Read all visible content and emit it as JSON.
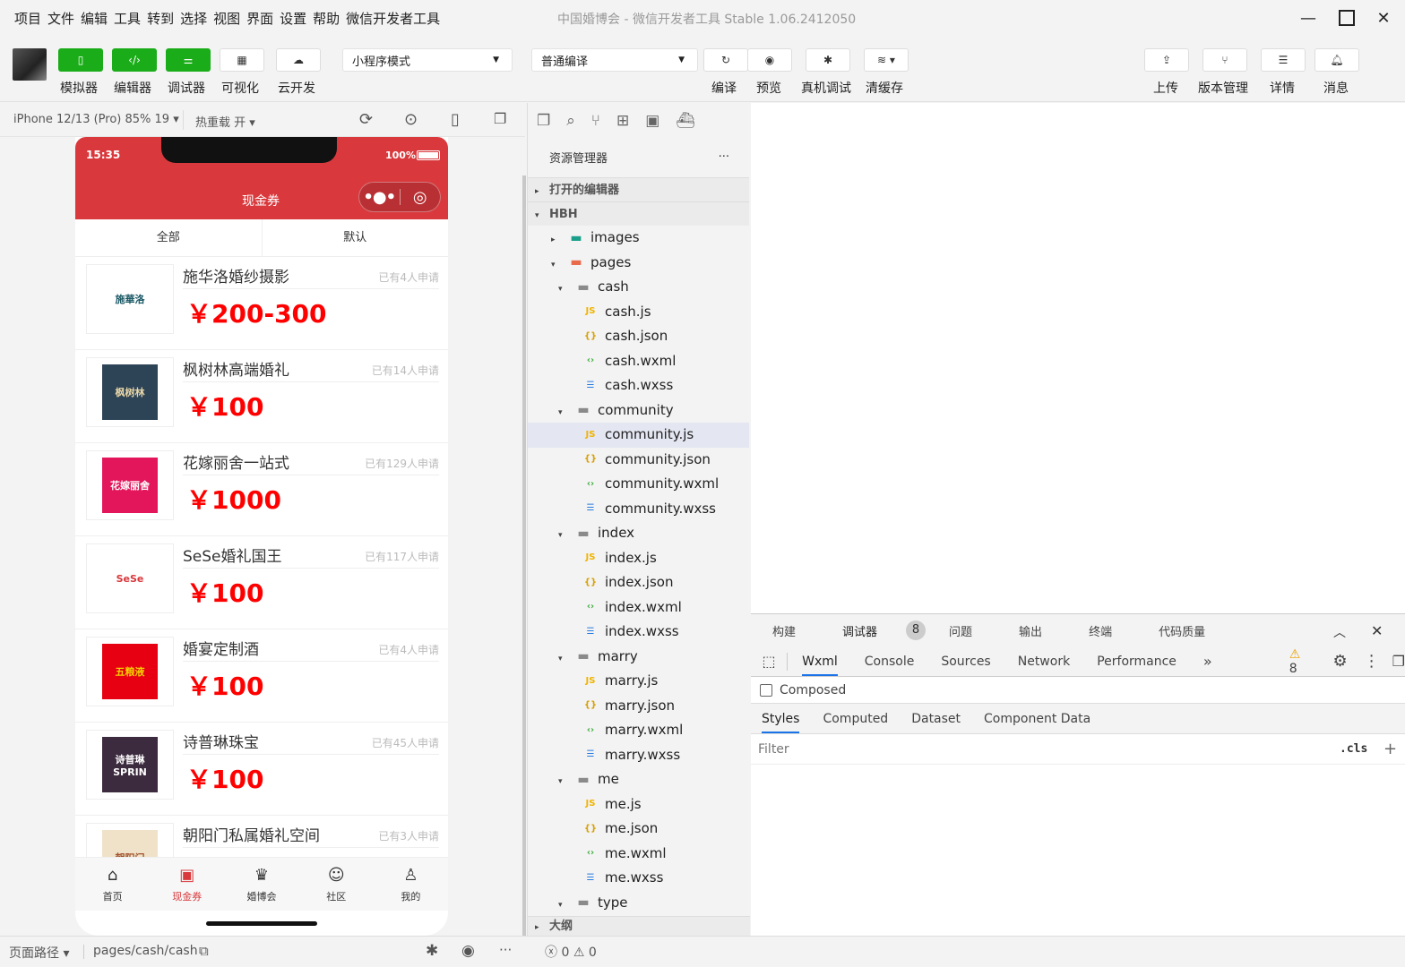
{
  "menu": [
    "项目",
    "文件",
    "编辑",
    "工具",
    "转到",
    "选择",
    "视图",
    "界面",
    "设置",
    "帮助",
    "微信开发者工具"
  ],
  "window_title": "中国婚博会 - 微信开发者工具 Stable 1.06.2412050",
  "toolbar": {
    "left_buttons": [
      {
        "label": "模拟器"
      },
      {
        "label": "编辑器"
      },
      {
        "label": "调试器"
      },
      {
        "label": "可视化"
      },
      {
        "label": "云开发"
      }
    ],
    "mode_select": "小程序模式",
    "compile_select": "普通编译",
    "mid_buttons": [
      {
        "label": "编译"
      },
      {
        "label": "预览"
      },
      {
        "label": "真机调试"
      },
      {
        "label": "清缓存"
      }
    ],
    "right_buttons": [
      {
        "label": "上传"
      },
      {
        "label": "版本管理"
      },
      {
        "label": "详情"
      },
      {
        "label": "消息"
      }
    ]
  },
  "simulator": {
    "device": "iPhone 12/13 (Pro) 85% 19",
    "hot_reload": "热重载 开"
  },
  "phone": {
    "time": "15:35",
    "battery": "100%",
    "nav_title": "现金券",
    "tabs": [
      "全部",
      "默认"
    ],
    "items": [
      {
        "name": "施华洛婚纱摄影",
        "applied": "已有4人申请",
        "price": "￥200-300",
        "logo_text": "施華洛",
        "logo_bg": "#ffffff",
        "logo_color": "#1c5a66"
      },
      {
        "name": "枫树林高端婚礼",
        "applied": "已有14人申请",
        "price": "￥100",
        "logo_text": "枫树林",
        "logo_bg": "#2d4356",
        "logo_color": "#e8d7a8"
      },
      {
        "name": "花嫁丽舍一站式",
        "applied": "已有129人申请",
        "price": "￥1000",
        "logo_text": "花嫁丽舍",
        "logo_bg": "#e3165b",
        "logo_color": "#ffffff"
      },
      {
        "name": "SeSe婚礼国王",
        "applied": "已有117人申请",
        "price": "￥100",
        "logo_text": "SeSe",
        "logo_bg": "#ffffff",
        "logo_color": "#d9393d"
      },
      {
        "name": "婚宴定制酒",
        "applied": "已有4人申请",
        "price": "￥100",
        "logo_text": "五粮液",
        "logo_bg": "#e60012",
        "logo_color": "#f5d000"
      },
      {
        "name": "诗普琳珠宝",
        "applied": "已有45人申请",
        "price": "￥100",
        "logo_text": "诗普琳 SPRIN",
        "logo_bg": "#3c2a3e",
        "logo_color": "#ffffff"
      },
      {
        "name": "朝阳门私属婚礼空间",
        "applied": "已有3人申请",
        "price": "",
        "logo_text": "朝阳门",
        "logo_bg": "#f0e2c8",
        "logo_color": "#a0522d"
      }
    ],
    "tabbar": [
      {
        "label": "首页",
        "icon": "home-icon"
      },
      {
        "label": "现金券",
        "icon": "coupon-icon"
      },
      {
        "label": "婚博会",
        "icon": "expo-icon"
      },
      {
        "label": "社区",
        "icon": "chat-icon"
      },
      {
        "label": "我的",
        "icon": "user-icon"
      }
    ]
  },
  "explorer": {
    "title": "资源管理器",
    "open_editors": "打开的编辑器",
    "project": "HBH",
    "tree": [
      {
        "label": "images",
        "depth": 1,
        "type": "folder-img",
        "caret": "▸"
      },
      {
        "label": "pages",
        "depth": 1,
        "type": "folder-pages",
        "caret": "▾"
      },
      {
        "label": "cash",
        "depth": 2,
        "type": "folder",
        "caret": "▾"
      },
      {
        "label": "cash.js",
        "depth": 3,
        "type": "js"
      },
      {
        "label": "cash.json",
        "depth": 3,
        "type": "json"
      },
      {
        "label": "cash.wxml",
        "depth": 3,
        "type": "wxml"
      },
      {
        "label": "cash.wxss",
        "depth": 3,
        "type": "wxss"
      },
      {
        "label": "community",
        "depth": 2,
        "type": "folder",
        "caret": "▾"
      },
      {
        "label": "community.js",
        "depth": 3,
        "type": "js",
        "selected": true
      },
      {
        "label": "community.json",
        "depth": 3,
        "type": "json"
      },
      {
        "label": "community.wxml",
        "depth": 3,
        "type": "wxml"
      },
      {
        "label": "community.wxss",
        "depth": 3,
        "type": "wxss"
      },
      {
        "label": "index",
        "depth": 2,
        "type": "folder",
        "caret": "▾"
      },
      {
        "label": "index.js",
        "depth": 3,
        "type": "js"
      },
      {
        "label": "index.json",
        "depth": 3,
        "type": "json"
      },
      {
        "label": "index.wxml",
        "depth": 3,
        "type": "wxml"
      },
      {
        "label": "index.wxss",
        "depth": 3,
        "type": "wxss"
      },
      {
        "label": "marry",
        "depth": 2,
        "type": "folder",
        "caret": "▾"
      },
      {
        "label": "marry.js",
        "depth": 3,
        "type": "js"
      },
      {
        "label": "marry.json",
        "depth": 3,
        "type": "json"
      },
      {
        "label": "marry.wxml",
        "depth": 3,
        "type": "wxml"
      },
      {
        "label": "marry.wxss",
        "depth": 3,
        "type": "wxss"
      },
      {
        "label": "me",
        "depth": 2,
        "type": "folder",
        "caret": "▾"
      },
      {
        "label": "me.js",
        "depth": 3,
        "type": "js"
      },
      {
        "label": "me.json",
        "depth": 3,
        "type": "json"
      },
      {
        "label": "me.wxml",
        "depth": 3,
        "type": "wxml"
      },
      {
        "label": "me.wxss",
        "depth": 3,
        "type": "wxss"
      },
      {
        "label": "type",
        "depth": 2,
        "type": "folder",
        "caret": "▾"
      }
    ],
    "outline": "大纲"
  },
  "devtools": {
    "top_tabs": [
      "构建",
      "调试器",
      "问题",
      "输出",
      "终端",
      "代码质量"
    ],
    "debugger_badge": "8",
    "tabs": [
      "Wxml",
      "Console",
      "Sources",
      "Network",
      "Performance"
    ],
    "more": "»",
    "warnings": "8",
    "composed_label": "Composed",
    "style_tabs": [
      "Styles",
      "Computed",
      "Dataset",
      "Component Data"
    ],
    "filter_placeholder": "Filter",
    "cls": ".cls",
    "plus": "+"
  },
  "bottom": {
    "path_label": "页面路径",
    "path": "pages/cash/cash",
    "errors": "0",
    "warnings": "0"
  }
}
